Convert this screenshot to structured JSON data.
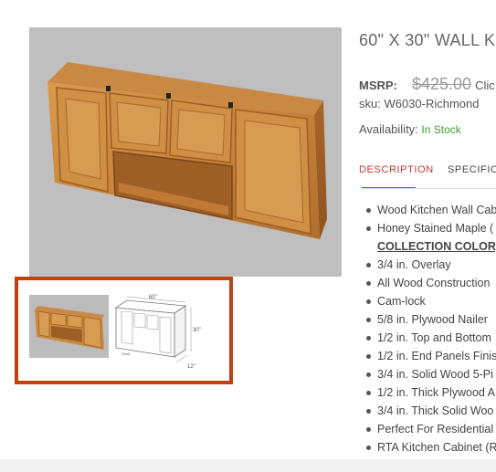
{
  "product": {
    "title": "60\" X 30\" WALL K",
    "msrp_label": "MSRP:",
    "msrp_value": "$425.00",
    "click_text": "Clic",
    "sku": "sku: W6030-Richmond",
    "availability_label": "Availability:",
    "availability_value": "In Stock"
  },
  "gallery": {
    "main_image": "wood-wall-cabinet-photo",
    "thumbnails": [
      "wood-wall-cabinet-photo",
      "cabinet-dimension-drawing"
    ],
    "drawing_labels": {
      "width": "60\"",
      "height": "30\"",
      "depth": "12\"",
      "shelf": "Shelf"
    }
  },
  "tabs": [
    {
      "label": "DESCRIPTION",
      "active": true
    },
    {
      "label": "SPECIFICA",
      "active": false
    }
  ],
  "features": [
    {
      "text": "Wood Kitchen Wall Cab",
      "bullet": true
    },
    {
      "text": "Honey Stained Maple (",
      "bullet": true
    },
    {
      "text": "COLLECTION COLOR)",
      "bullet": false,
      "link": true
    },
    {
      "text": "3/4 in. Overlay",
      "bullet": true
    },
    {
      "text": "All Wood Construction",
      "bullet": true
    },
    {
      "text": "Cam-lock",
      "bullet": true
    },
    {
      "text": "5/8 in. Plywood Nailer",
      "bullet": true
    },
    {
      "text": "1/2 in. Top and Bottom",
      "bullet": true
    },
    {
      "text": "1/2 in. End Panels Finis",
      "bullet": true
    },
    {
      "text": "3/4 in. Solid Wood 5-Pi",
      "bullet": true
    },
    {
      "text": "1/2 in. Thick Plywood A",
      "bullet": true
    },
    {
      "text": "3/4 in. Thick Solid Woo",
      "bullet": true
    },
    {
      "text": "Perfect For Residential",
      "bullet": true
    },
    {
      "text": "RTA Kitchen Cabinet (R",
      "bullet": true
    }
  ],
  "colors": {
    "accent": "#c0392b",
    "thumb_border": "#c0430f",
    "in_stock": "#3a9a3a",
    "image_background": "#bfbfbf"
  }
}
